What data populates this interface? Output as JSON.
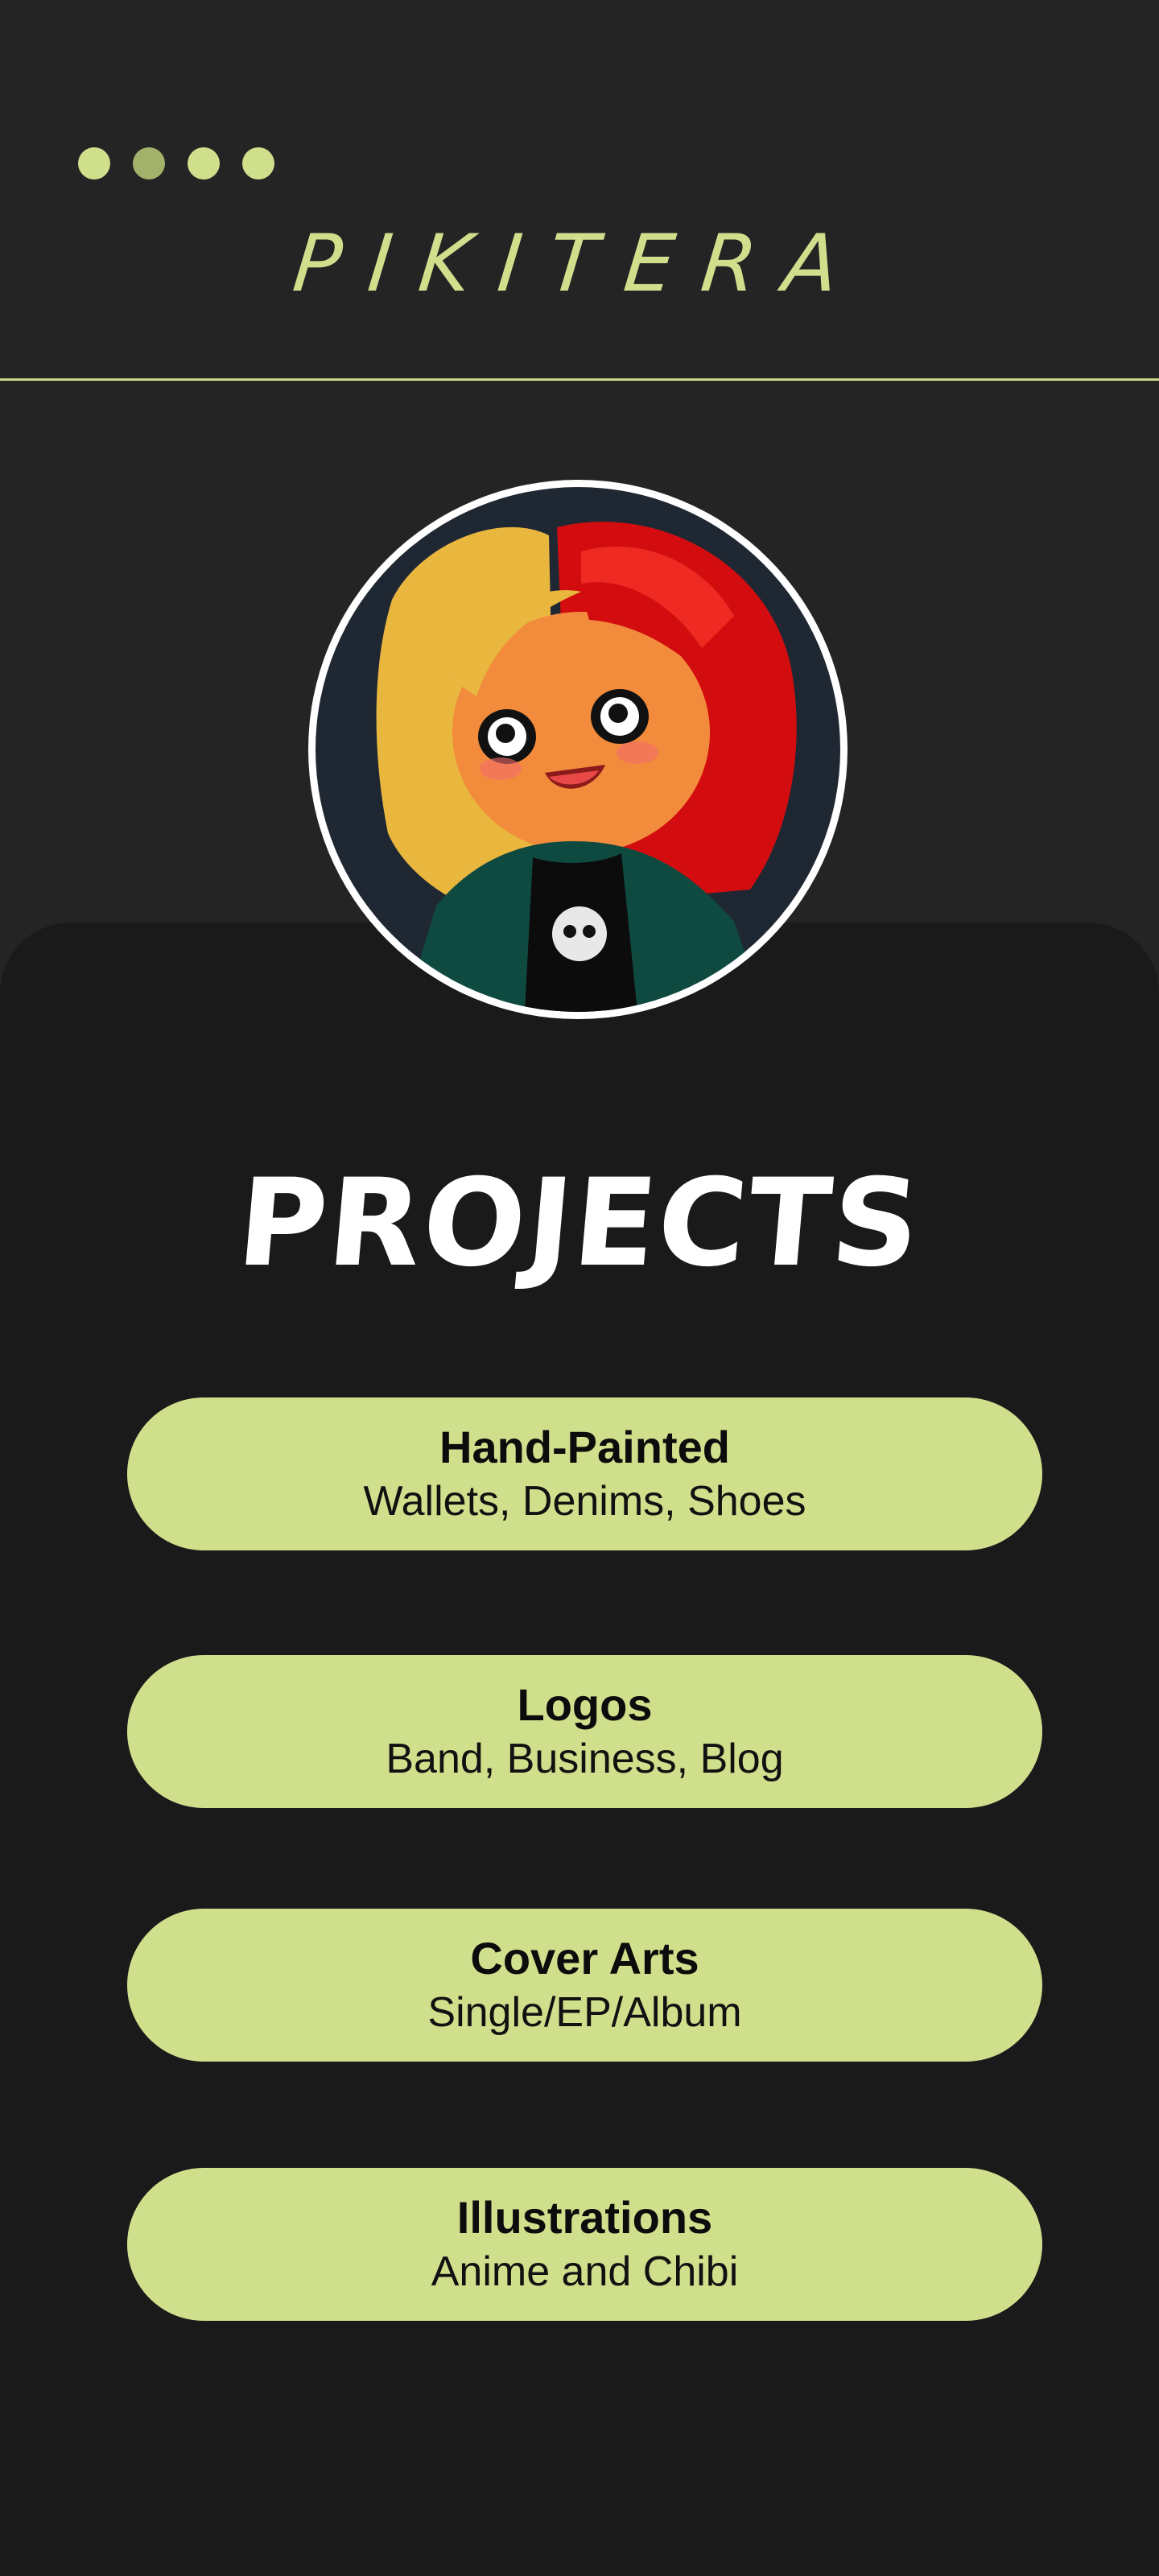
{
  "header": {
    "brand": "PIKITERA",
    "nav_dots": [
      {
        "name": "nav-dot-1",
        "active": false
      },
      {
        "name": "nav-dot-2",
        "active": true
      },
      {
        "name": "nav-dot-3",
        "active": false
      },
      {
        "name": "nav-dot-4",
        "active": false
      }
    ]
  },
  "colors": {
    "accent": "#d0df8c",
    "header_bg": "#242424",
    "panel_bg": "#1a1a1a",
    "pill_bg": "#cfdf8c"
  },
  "main": {
    "title": "PROJECTS",
    "projects": [
      {
        "title": "Hand-Painted",
        "subtitle": "Wallets, Denims, Shoes"
      },
      {
        "title": "Logos",
        "subtitle": "Band, Business, Blog"
      },
      {
        "title": "Cover Arts",
        "subtitle": "Single/EP/Album"
      },
      {
        "title": "Illustrations",
        "subtitle": "Anime and Chibi"
      }
    ]
  }
}
